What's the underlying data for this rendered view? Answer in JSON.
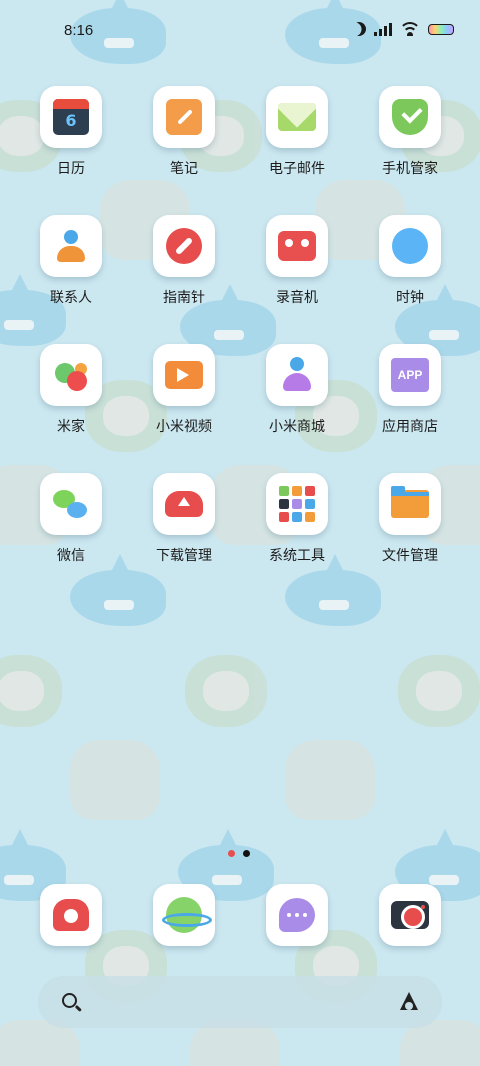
{
  "status_bar": {
    "time": "8:16",
    "icons": [
      "moon-icon",
      "signal-icon",
      "wifi-icon",
      "battery-icon"
    ]
  },
  "apps": [
    {
      "label": "日历",
      "icon": "calendar-icon",
      "calendar_day": "6"
    },
    {
      "label": "笔记",
      "icon": "notes-icon"
    },
    {
      "label": "电子邮件",
      "icon": "mail-icon"
    },
    {
      "label": "手机管家",
      "icon": "shield-icon"
    },
    {
      "label": "联系人",
      "icon": "contacts-icon"
    },
    {
      "label": "指南针",
      "icon": "compass-icon"
    },
    {
      "label": "录音机",
      "icon": "recorder-icon"
    },
    {
      "label": "时钟",
      "icon": "clock-icon"
    },
    {
      "label": "米家",
      "icon": "mijia-icon"
    },
    {
      "label": "小米视频",
      "icon": "video-icon"
    },
    {
      "label": "小米商城",
      "icon": "store-icon"
    },
    {
      "label": "应用商店",
      "icon": "app-store-icon",
      "badge_text": "APP"
    },
    {
      "label": "微信",
      "icon": "wechat-icon"
    },
    {
      "label": "下载管理",
      "icon": "download-icon"
    },
    {
      "label": "系统工具",
      "icon": "folder-icon"
    },
    {
      "label": "文件管理",
      "icon": "files-icon"
    }
  ],
  "dock": [
    {
      "icon": "phone-icon"
    },
    {
      "icon": "browser-icon"
    },
    {
      "icon": "messages-icon"
    },
    {
      "icon": "camera-icon"
    }
  ],
  "search_bar": {
    "left_icon": "search-icon",
    "right_icon": "assistant-icon"
  },
  "colors": {
    "wallpaper": "#cbe7f0",
    "tile": "#ffffff",
    "label": "#1c1c1c"
  }
}
